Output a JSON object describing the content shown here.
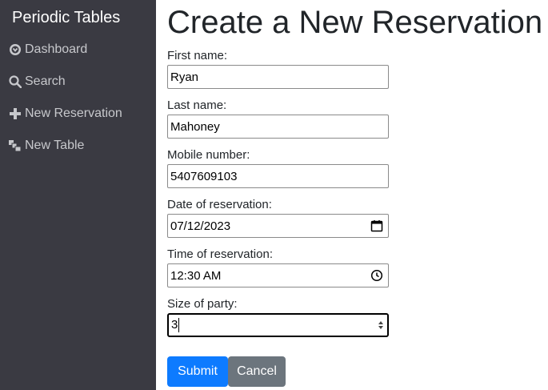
{
  "sidebar": {
    "brand": "Periodic Tables",
    "items": [
      {
        "label": "Dashboard",
        "icon": "dashboard-icon"
      },
      {
        "label": "Search",
        "icon": "search-icon"
      },
      {
        "label": "New Reservation",
        "icon": "plus-icon"
      },
      {
        "label": "New Table",
        "icon": "layers-icon"
      }
    ]
  },
  "main": {
    "title": "Create a New Reservation",
    "form": {
      "first_name": {
        "label": "First name:",
        "value": "Ryan"
      },
      "last_name": {
        "label": "Last name:",
        "value": "Mahoney"
      },
      "mobile_number": {
        "label": "Mobile number:",
        "value": "5407609103"
      },
      "reservation_date": {
        "label": "Date of reservation:",
        "value": "07/12/2023"
      },
      "reservation_time": {
        "label": "Time of reservation:",
        "value": "12:30 AM"
      },
      "people": {
        "label": "Size of party:",
        "value": "3"
      }
    },
    "buttons": {
      "submit": "Submit",
      "cancel": "Cancel"
    }
  },
  "colors": {
    "sidebar_bg": "#3a3a42",
    "primary": "#0d7bff",
    "secondary": "#6c757d"
  }
}
